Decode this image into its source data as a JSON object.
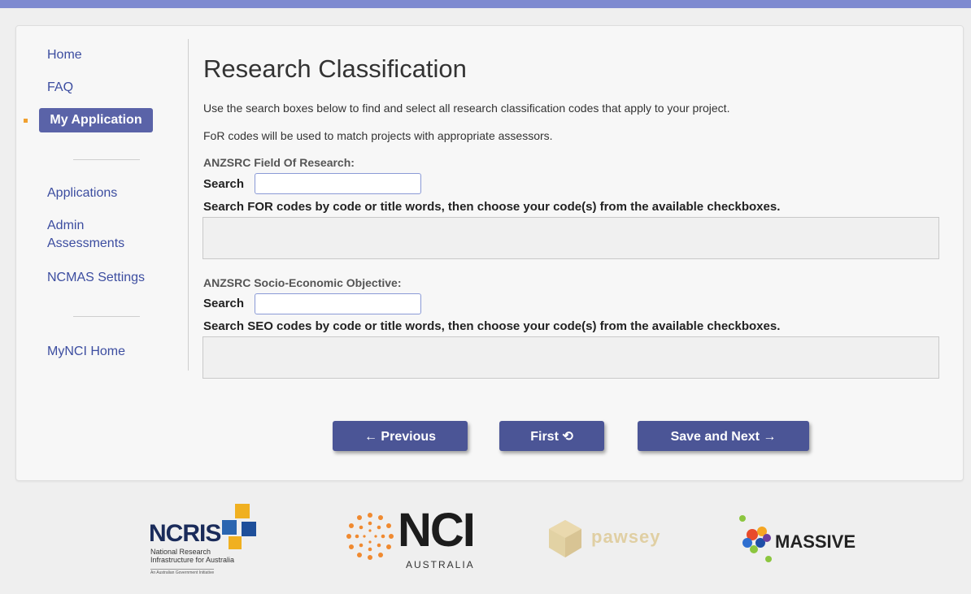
{
  "nav": {
    "home": "Home",
    "faq": "FAQ",
    "my_application": "My Application",
    "applications": "Applications",
    "admin_assessments": "Admin Assessments",
    "ncmas_settings": "NCMAS Settings",
    "mynci_home": "MyNCI Home"
  },
  "page": {
    "title": "Research Classification",
    "intro": "Use the search boxes below to find and select all research classification codes that apply to your project.",
    "note": "FoR codes will be used to match projects with appropriate assessors."
  },
  "for_section": {
    "title": "ANZSRC Field Of Research:",
    "search_label": "Search",
    "search_value": "",
    "hint": "Search FOR codes by code or title words, then choose your code(s) from the available checkboxes."
  },
  "seo_section": {
    "title": "ANZSRC Socio-Economic Objective:",
    "search_label": "Search",
    "search_value": "",
    "hint": "Search SEO codes by code or title words, then choose your code(s) from the available checkboxes."
  },
  "buttons": {
    "previous": "← Previous",
    "first": "First ⟲",
    "save_next": "Save and Next →"
  },
  "logos": {
    "ncris": "NCRIS",
    "ncris_sub1": "National Research",
    "ncris_sub2": "Infrastructure for Australia",
    "ncris_sub3": "An Australian Government Initiative",
    "nci": "NCI",
    "nci_sub": "AUSTRALIA",
    "pawsey": "pawsey",
    "massive": "MASSIVE"
  },
  "colors": {
    "accent": "#5a63a8",
    "button": "#4b5596",
    "topbar": "#7f8bd0",
    "link": "#3c4da0"
  }
}
